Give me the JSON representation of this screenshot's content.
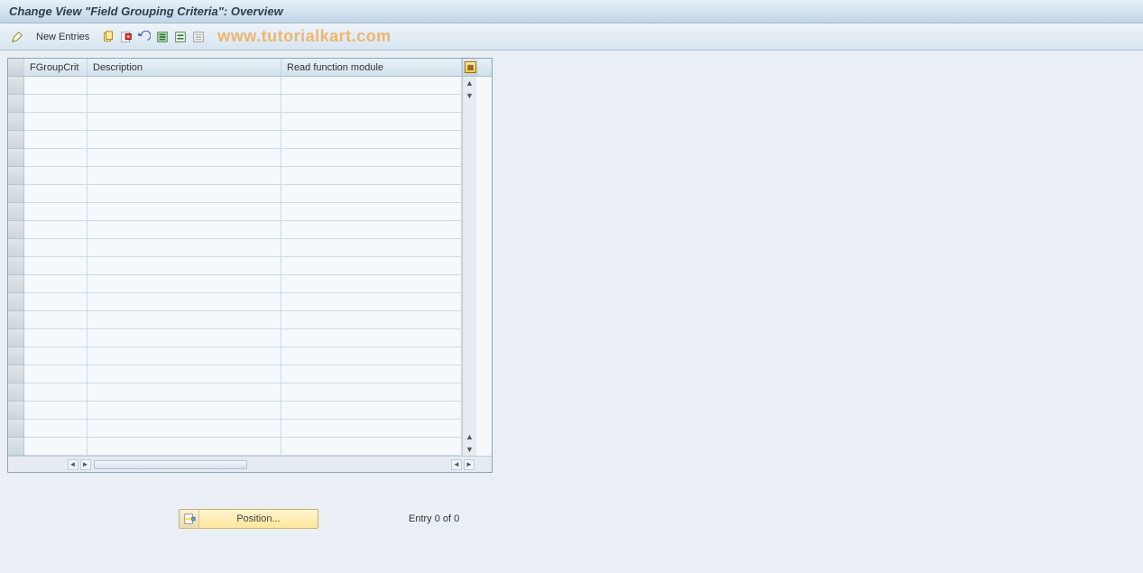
{
  "title": "Change View \"Field Grouping Criteria\": Overview",
  "toolbar": {
    "new_entries_label": "New Entries"
  },
  "watermark": "www.tutorialkart.com",
  "table": {
    "columns": {
      "fgroup": "FGroupCrit",
      "desc": "Description",
      "read": "Read function module"
    },
    "row_count": 21
  },
  "footer": {
    "position_label": "Position...",
    "entry_text": "Entry 0 of 0"
  }
}
